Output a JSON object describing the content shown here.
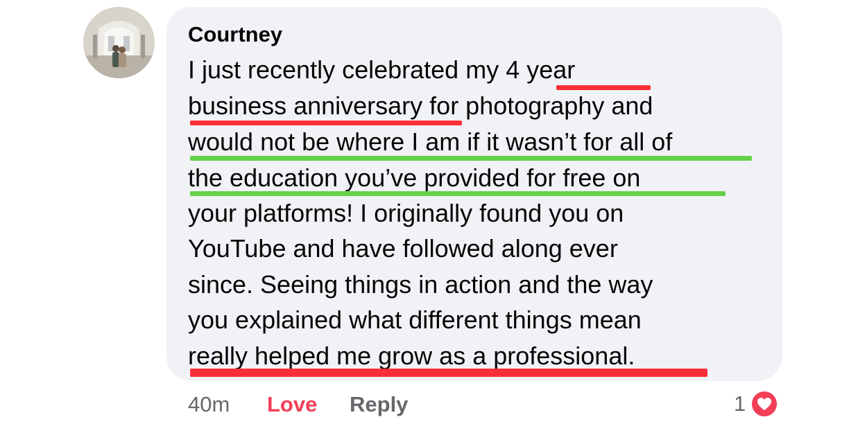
{
  "comment": {
    "author": "Courtney",
    "avatar_icon": "profile-photo-couple-icon",
    "text_lines": [
      "I just recently celebrated my 4 year",
      "business anniversary for photography and",
      "would not be where I am if it wasn’t for all of",
      "the education you’ve provided for free on",
      "your platforms! I originally found you on",
      "YouTube and have followed along ever",
      "since. Seeing things in action and the way",
      "you explained what different things mean",
      "really helped me grow as a professional."
    ],
    "highlight_colors": {
      "red": "#fb2f38",
      "green": "#63d14a"
    }
  },
  "actions": {
    "time": "40m",
    "love_label": "Love",
    "reply_label": "Reply"
  },
  "reactions": {
    "count": "1",
    "icon": "heart-icon",
    "color": "#f33e58"
  },
  "colors": {
    "bubble": "#f0f2f5",
    "meta_text": "#65676b"
  }
}
